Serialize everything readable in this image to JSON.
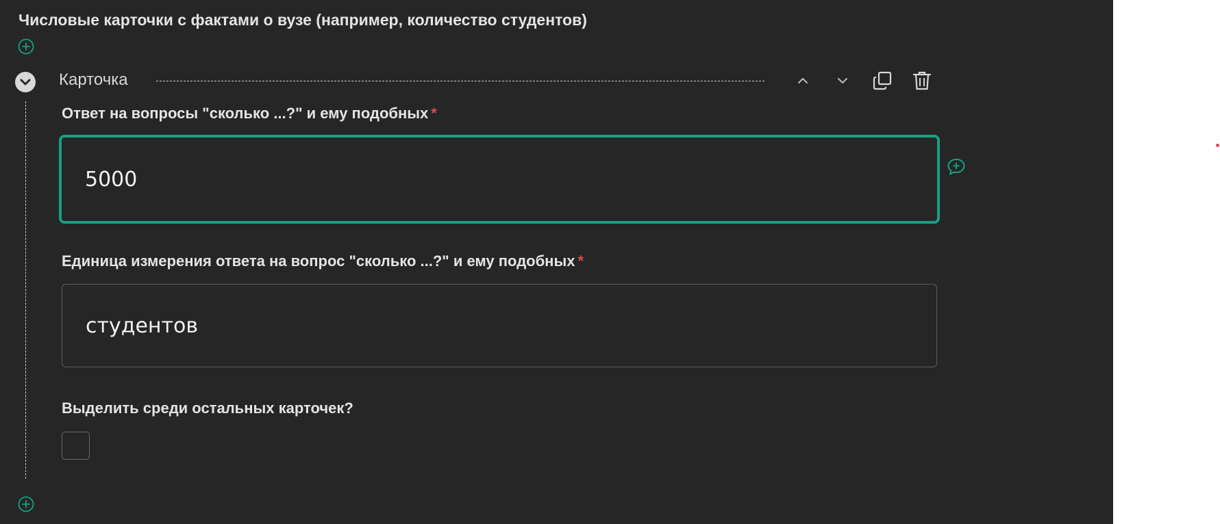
{
  "section": {
    "title": "Числовые карточки с фактами о вузе (например, количество студентов)"
  },
  "card": {
    "title": "Карточка",
    "fields": {
      "answer": {
        "label": "Ответ на вопросы \"сколько ...?\" и ему подобных",
        "required_mark": "*",
        "value": "5000"
      },
      "unit": {
        "label": "Единица измерения ответа на вопрос \"сколько ...?\" и ему подобных",
        "required_mark": "*",
        "value": "студентов"
      },
      "highlight": {
        "label": "Выделить среди остальных карточек?",
        "checked": false
      }
    }
  },
  "icons": {
    "add_top": "add-circle-icon",
    "add_bottom": "add-circle-icon",
    "collapse": "chevron-down-icon",
    "move_up": "chevron-up-icon",
    "move_down": "chevron-down-icon",
    "duplicate": "copy-icon",
    "delete": "trash-icon",
    "comment": "add-comment-icon"
  },
  "colors": {
    "panel_background": "#262626",
    "accent": "#16a083",
    "required": "#e0474c"
  }
}
